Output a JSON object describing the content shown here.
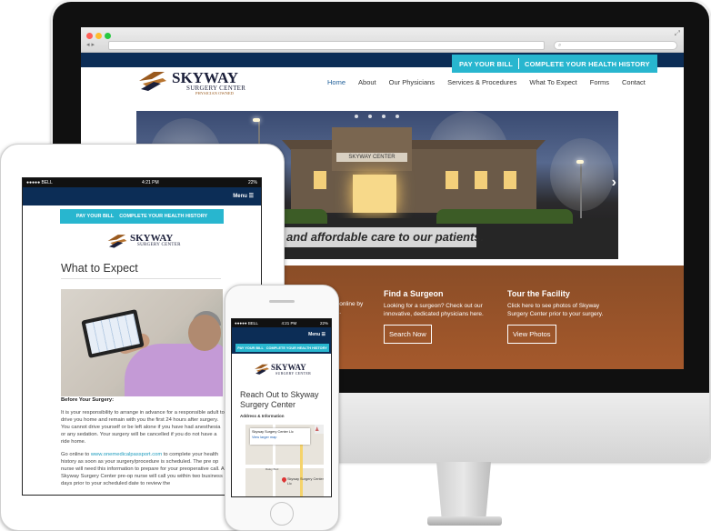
{
  "desktop": {
    "browser": {
      "search_placeholder": ""
    },
    "header": {
      "cta_pay": "PAY YOUR BILL",
      "cta_history": "COMPLETE YOUR HEALTH HISTORY",
      "logo_line1": "SKYWAY",
      "logo_line2": "SURGERY CENTER",
      "logo_line3": "PHYSICIAN OWNED"
    },
    "nav": {
      "items": [
        "Home",
        "About",
        "Our Physicians",
        "Services & Procedures",
        "What To Expect",
        "Forms",
        "Contact"
      ],
      "active": "Home"
    },
    "hero": {
      "sign_text": "SKYWAY CENTER",
      "caption": "and affordable care to our patients.",
      "slide_count": 4
    },
    "features": {
      "partial_text_1": "l online by",
      "partial_text_2": "k.",
      "surgeon": {
        "title": "Find a Surgeon",
        "text": "Looking for a surgeon? Check out our innovative, dedicated physicians here.",
        "button": "Search Now"
      },
      "facility": {
        "title": "Tour the Facility",
        "text": "Click here to see photos of Skyway Surgery Center prior to your surgery.",
        "button": "View Photos"
      }
    }
  },
  "tablet": {
    "status_carrier": "●●●●● BELL",
    "status_time": "4:21 PM",
    "status_battery": "22%",
    "menu_label": "Menu ☰",
    "cta_pay": "PAY YOUR BILL",
    "cta_history": "COMPLETE YOUR HEALTH HISTORY",
    "logo_line1": "SKYWAY",
    "logo_line2": "SURGERY CENTER",
    "page_title": "What to Expect",
    "before_heading": "Before Your Surgery:",
    "para1": "It is your responsibility to arrange in advance for a responsible adult to drive you home and remain with you the first 24 hours after surgery. You cannot drive yourself or be left alone if you have had anesthesia or any sedation. Your surgery will be cancelled if you do not have a ride home.",
    "para2_prefix": "Go online to ",
    "para2_link": "www.onemedicalpassport.com",
    "para2_rest": " to complete your health history as soon as your surgery/procedure is scheduled. The pre op nurse will need this information to prepare for your preoperative call.   A Skyway Surgery Center pre-op nurse will call you within two business days prior to your scheduled date to review the"
  },
  "phone": {
    "status_carrier": "●●●●● BELL",
    "status_time": "4:21 PM",
    "status_battery": "22%",
    "menu_label": "Menu ☰",
    "cta_pay": "PAY YOUR BILL",
    "cta_history": "COMPLETE YOUR HEALTH HISTORY",
    "logo_line1": "SKYWAY",
    "logo_line2": "SURGERY CENTER",
    "title": "Reach Out to Skyway Surgery Center",
    "subtitle": "Address & Information",
    "map_card_title": "Skyway Surgery Center Llc",
    "map_card_link": "View larger map",
    "map_street": "Raley Blvd",
    "map_pin_label": "Skyway Surgery Center Llc"
  }
}
